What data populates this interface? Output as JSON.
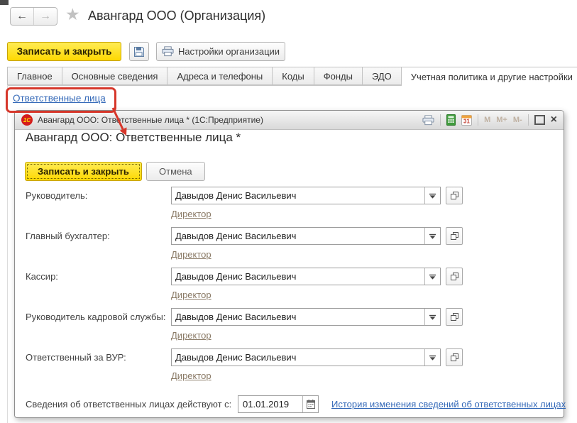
{
  "header": {
    "title": "Авангард ООО (Организация)"
  },
  "icons": {
    "back": "←",
    "forward": "→",
    "star": "★",
    "close": "×",
    "one_c_logo": "1С",
    "calendar_day": "31"
  },
  "toolbar": {
    "save_close": "Записать и закрыть",
    "org_settings": "Настройки организации"
  },
  "tabs": [
    {
      "label": "Главное"
    },
    {
      "label": "Основные сведения"
    },
    {
      "label": "Адреса и телефоны"
    },
    {
      "label": "Коды"
    },
    {
      "label": "Фонды"
    },
    {
      "label": "ЭДО"
    },
    {
      "label": "Учетная политика и другие настройки"
    }
  ],
  "content": {
    "responsible_link": "Ответственные лица"
  },
  "dialog": {
    "titlebar": {
      "title": "Авангард ООО: Ответственные лица *  (1С:Предприятие)",
      "memory": [
        "M",
        "M+",
        "M-"
      ]
    },
    "heading": "Авангард ООО: Ответственные лица *",
    "buttons": {
      "save_close": "Записать и закрыть",
      "cancel": "Отмена"
    },
    "fields": [
      {
        "label": "Руководитель:",
        "value": "Давыдов Денис Васильевич",
        "position": "Директор"
      },
      {
        "label": "Главный бухгалтер:",
        "value": "Давыдов Денис Васильевич",
        "position": "Директор"
      },
      {
        "label": "Кассир:",
        "value": "Давыдов Денис Васильевич",
        "position": "Директор"
      },
      {
        "label": "Руководитель кадровой службы:",
        "value": "Давыдов Денис Васильевич",
        "position": "Директор"
      },
      {
        "label": "Ответственный за ВУР:",
        "value": "Давыдов Денис Васильевич",
        "position": "Директор"
      }
    ],
    "footer": {
      "label": "Сведения об ответственных лицах действуют с:",
      "date": "01.01.2019",
      "history_link": "История изменения сведений об ответственных лицах"
    }
  },
  "colors": {
    "accent_yellow": "#fed801",
    "link_blue": "#3469b8",
    "annotation_red": "#d6372b",
    "position_link_brown": "#8a7a66"
  }
}
